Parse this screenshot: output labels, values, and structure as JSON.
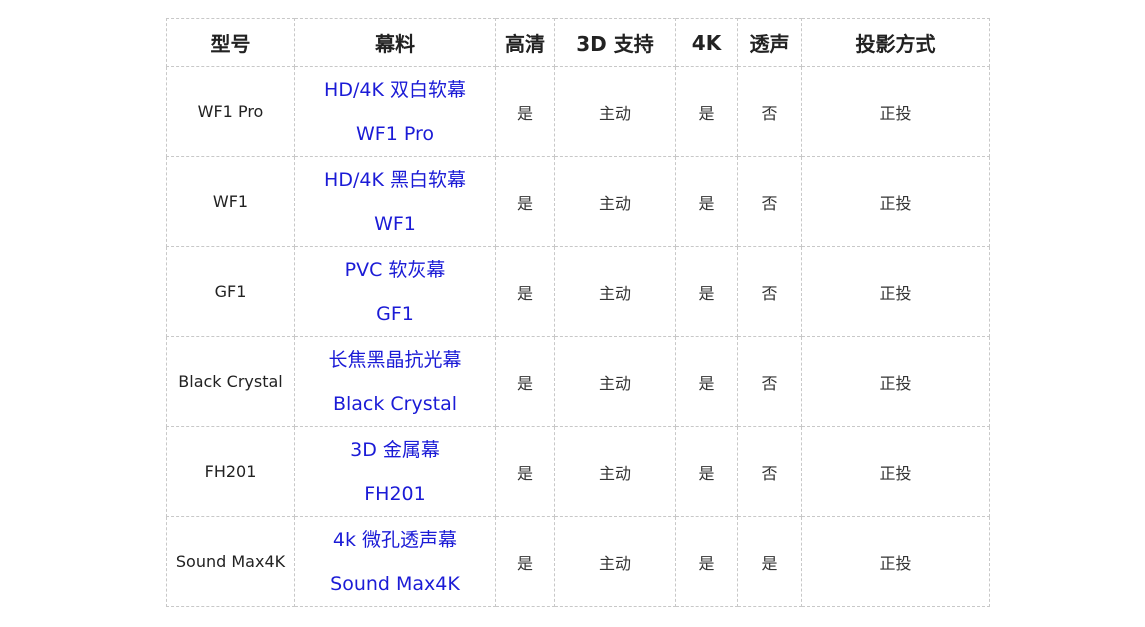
{
  "headers": [
    "型号",
    "幕料",
    "高清",
    "3D 支持",
    "4K",
    "透声",
    "投影方式"
  ],
  "rows": [
    {
      "model": "WF1 Pro",
      "material_line1": "HD/4K 双白软幕",
      "material_line2": "WF1 Pro",
      "hd": "是",
      "support3d": "主动",
      "k4": "是",
      "sound": "否",
      "projection": "正投"
    },
    {
      "model": "WF1",
      "material_line1": "HD/4K 黑白软幕",
      "material_line2": "WF1",
      "hd": "是",
      "support3d": "主动",
      "k4": "是",
      "sound": "否",
      "projection": "正投"
    },
    {
      "model": "GF1",
      "material_line1": "PVC 软灰幕",
      "material_line2": "GF1",
      "hd": "是",
      "support3d": "主动",
      "k4": "是",
      "sound": "否",
      "projection": "正投"
    },
    {
      "model": "Black Crystal",
      "material_line1": "长焦黑晶抗光幕",
      "material_line2": "Black Crystal",
      "hd": "是",
      "support3d": "主动",
      "k4": "是",
      "sound": "否",
      "projection": "正投"
    },
    {
      "model": "FH201",
      "material_line1": "3D 金属幕",
      "material_line2": "FH201",
      "hd": "是",
      "support3d": "主动",
      "k4": "是",
      "sound": "否",
      "projection": "正投"
    },
    {
      "model": "Sound Max4K",
      "material_line1": "4k 微孔透声幕",
      "material_line2": "Sound Max4K",
      "hd": "是",
      "support3d": "主动",
      "k4": "是",
      "sound": "是",
      "projection": "正投"
    }
  ],
  "colors": {
    "material_text": "#1b1bd6",
    "border": "#c8c8c8",
    "body_text": "#333333"
  }
}
